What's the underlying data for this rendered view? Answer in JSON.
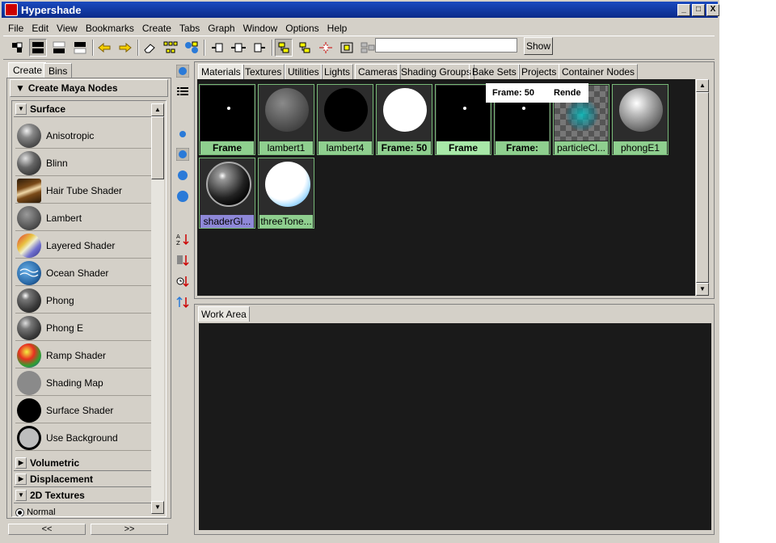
{
  "window": {
    "title": "Hypershade",
    "controls": [
      "_",
      "□",
      "X"
    ]
  },
  "menu": [
    "File",
    "Edit",
    "View",
    "Bookmarks",
    "Create",
    "Tabs",
    "Graph",
    "Window",
    "Options",
    "Help"
  ],
  "toolbar": {
    "search_value": "",
    "show_label": "Show"
  },
  "left_panel": {
    "tabs": [
      "Create",
      "Bins"
    ],
    "header": "Create Maya Nodes",
    "sections": {
      "surface": "Surface",
      "volumetric": "Volumetric",
      "displacement": "Displacement",
      "textures2d": "2D Textures",
      "normal": "Normal"
    },
    "items": [
      "Anisotropic",
      "Blinn",
      "Hair Tube Shader",
      "Lambert",
      "Layered Shader",
      "Ocean Shader",
      "Phong",
      "Phong E",
      "Ramp Shader",
      "Shading Map",
      "Surface Shader",
      "Use Background"
    ],
    "nav": [
      "<<",
      ">>"
    ]
  },
  "top_tabs": [
    "Materials",
    "Textures",
    "Utilities",
    "Lights",
    "Cameras",
    "Shading Groups",
    "Bake Sets",
    "Projects",
    "Container Nodes"
  ],
  "materials": [
    "Frame",
    "lambert1",
    "lambert4",
    "Frame: 50",
    "Frame",
    "Frame:",
    "particleCl...",
    "phongE1",
    "shaderGl...",
    "threeTone..."
  ],
  "tooltip": {
    "frame": "Frame: 50",
    "render": "Rende"
  },
  "work_area": {
    "tab": "Work Area"
  },
  "colors": {
    "title_bar": "#0a2a8a",
    "panel_bg": "#1a1a1a",
    "thumb_caption": "#8fcf8f",
    "selected_caption": "#8e88d8"
  }
}
